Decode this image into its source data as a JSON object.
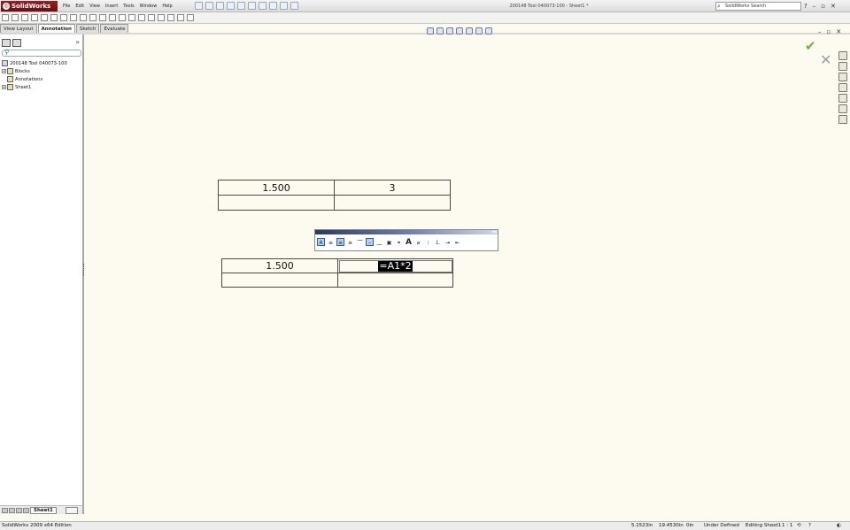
{
  "app": {
    "logo": "SolidWorks",
    "document_title": "200148 Tool 040073-100 - Sheet1 *"
  },
  "menu": [
    "File",
    "Edit",
    "View",
    "Insert",
    "Tools",
    "Window",
    "Help"
  ],
  "search": {
    "placeholder": "SolidWorks Search",
    "help": "?"
  },
  "window_controls": {
    "minimize": "–",
    "restore": "▫",
    "close": "✕"
  },
  "command_tabs": [
    {
      "label": "View Layout",
      "active": false
    },
    {
      "label": "Annotation",
      "active": true
    },
    {
      "label": "Sketch",
      "active": false
    },
    {
      "label": "Evaluate",
      "active": false
    }
  ],
  "feature_tree": {
    "root": "200148 Tool 040073-100",
    "items": [
      {
        "label": "Blocks",
        "expandable": true
      },
      {
        "label": "Annotations",
        "expandable": false
      },
      {
        "label": "Sheet1",
        "expandable": true
      }
    ],
    "collapse_chevron": "»"
  },
  "sheet_tabs": {
    "active": "Sheet1"
  },
  "tables": {
    "table1": {
      "rows": [
        [
          "1.500",
          "3"
        ],
        [
          "",
          ""
        ]
      ]
    },
    "table2": {
      "rows": [
        [
          "1.500",
          "=A1*2"
        ],
        [
          "",
          ""
        ]
      ],
      "editing_cell": "=A1*2"
    }
  },
  "formatting_toolbar": {
    "icons": [
      "table-props-icon",
      "align-left-icon",
      "align-center-icon",
      "align-right-icon",
      "align-top-icon",
      "align-middle-icon",
      "align-bottom-icon",
      "insert-icon",
      "link-icon",
      "font-icon",
      "symbol-icon",
      "bullets-icon",
      "numbering-icon",
      "indent-icon",
      "outdent-icon"
    ]
  },
  "status_bar": {
    "edition": "SolidWorks 2009 x64 Edition",
    "x": "5.1523in",
    "y": "19.4530in",
    "z": "0in",
    "state": "Under Defined",
    "editing": "Editing Sheet1",
    "scale": "1 : 1"
  },
  "colors": {
    "accept": "#5bbd3a",
    "cancel": "#9aa0a6",
    "canvas": "#fdfbf0",
    "logo": "#8b1515"
  }
}
